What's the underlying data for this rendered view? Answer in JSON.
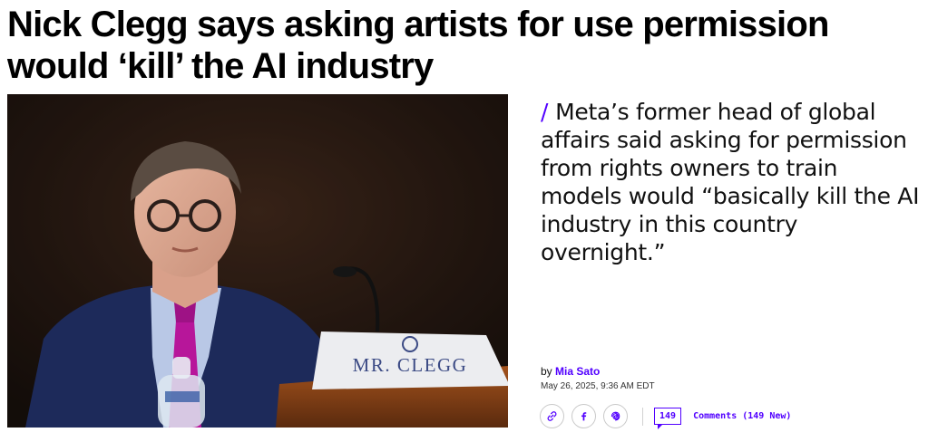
{
  "article": {
    "headline": "Nick Clegg says asking artists for use permission would ‘kill’ the AI industry",
    "dek": "Meta’s former head of global affairs said asking for permission from rights owners to train models would “basically kill the AI industry in this country overnight.”",
    "dek_slash": "/",
    "nameplate": "MR. CLEGG",
    "byline_prefix": "by",
    "author": "Mia Sato",
    "date": "May 26, 2025, 9:36 AM EDT"
  },
  "share": {
    "items": [
      {
        "name": "copy-link",
        "icon": "link-icon"
      },
      {
        "name": "facebook",
        "icon": "facebook-icon"
      },
      {
        "name": "threads",
        "icon": "threads-icon"
      }
    ]
  },
  "comments": {
    "count": "149",
    "label": "Comments (149 New)"
  },
  "colors": {
    "accent": "#5200ff",
    "tie": "#b7169a",
    "suit": "#1d2a5a"
  }
}
